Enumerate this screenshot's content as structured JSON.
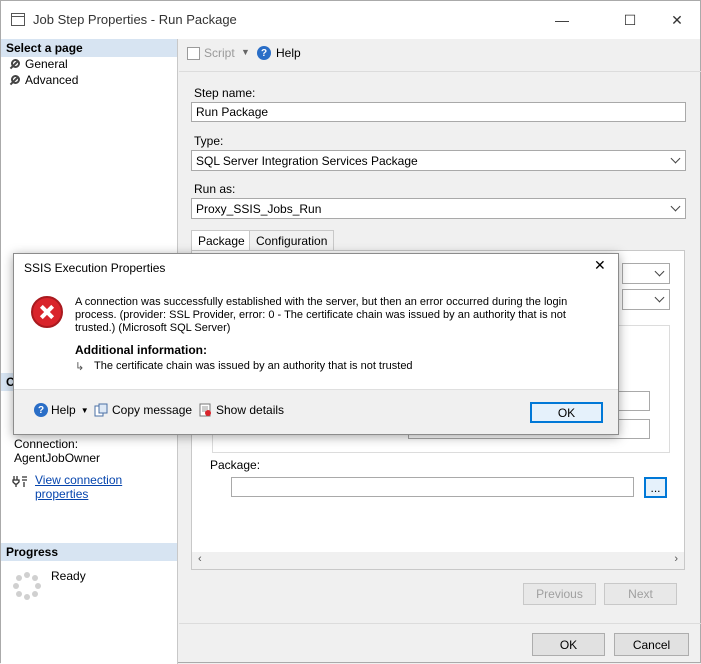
{
  "window": {
    "title": "Job Step Properties - Run Package",
    "minimize": "—",
    "maximize": "☐",
    "close": "✕"
  },
  "left_pane": {
    "select_page_header": "Select a page",
    "pages": [
      {
        "label": "General",
        "icon": "wrench-icon"
      },
      {
        "label": "Advanced",
        "icon": "wrench-icon"
      }
    ],
    "connection_header_initial": "C",
    "connection_label": "Connection:",
    "connection_value": "AgentJobOwner",
    "view_connection_properties": "View connection properties",
    "progress_header": "Progress",
    "progress_status": "Ready"
  },
  "toolbar": {
    "script_label": "Script",
    "help_label": "Help"
  },
  "form": {
    "step_name_label": "Step name:",
    "step_name_value": "Run Package",
    "type_label": "Type:",
    "type_value": "SQL Server Integration Services Package",
    "run_as_label": "Run as:",
    "run_as_value": "Proxy_SSIS_Jobs_Run",
    "tabs": [
      "Package",
      "Configuration"
    ],
    "package_label": "Package:",
    "package_value": "",
    "browse_button": "...",
    "previous_button": "Previous",
    "next_button": "Next",
    "ok_button": "OK",
    "cancel_button": "Cancel"
  },
  "dialog": {
    "title": "SSIS Execution Properties",
    "message": "A connection was successfully established with the server, but then an error occurred during the login process. (provider: SSL Provider, error: 0 - The certificate chain was issued by an authority that is not trusted.) (Microsoft SQL Server)",
    "additional_info_header": "Additional information:",
    "additional_info_detail": "The certificate chain was issued by an authority that is not trusted",
    "help_label": "Help",
    "copy_message_label": "Copy message",
    "show_details_label": "Show details",
    "ok_label": "OK",
    "close": "✕"
  }
}
